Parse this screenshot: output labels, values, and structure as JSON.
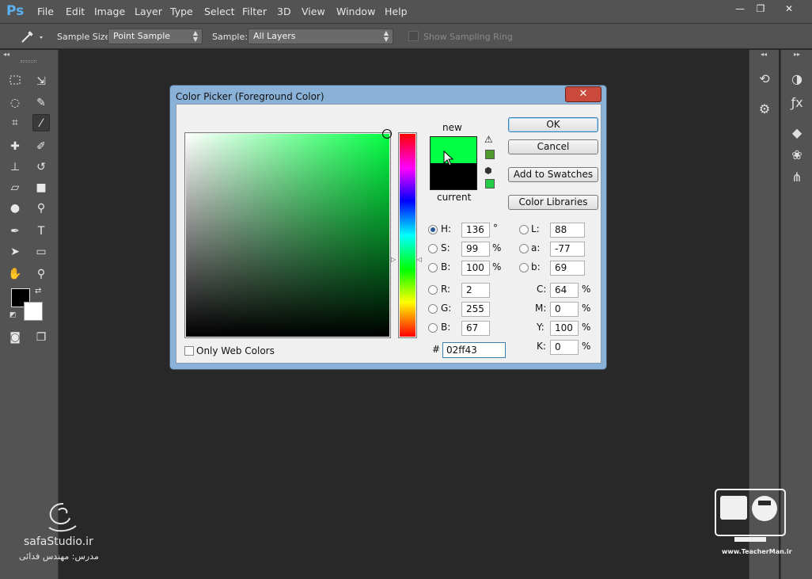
{
  "app": {
    "logo": "Ps"
  },
  "menu": [
    "File",
    "Edit",
    "Image",
    "Layer",
    "Type",
    "Select",
    "Filter",
    "3D",
    "View",
    "Window",
    "Help"
  ],
  "window_controls": {
    "minimize": "—",
    "restore": "❐",
    "close": "✕"
  },
  "options": {
    "sample_size_label": "Sample Size:",
    "sample_size_value": "Point Sample",
    "sample_label": "Sample:",
    "sample_value": "All Layers",
    "sampling_ring_label": "Show Sampling Ring"
  },
  "dialog": {
    "title": "Color Picker (Foreground Color)",
    "close": "✕",
    "new_label": "new",
    "current_label": "current",
    "buttons": {
      "ok": "OK",
      "cancel": "Cancel",
      "add_swatches": "Add to Swatches",
      "color_libraries": "Color Libraries"
    },
    "only_web_colors": "Only Web Colors",
    "hsb": {
      "h_label": "H:",
      "h": "136",
      "h_unit": "°",
      "s_label": "S:",
      "s": "99",
      "s_unit": "%",
      "b_label": "B:",
      "b": "100",
      "b_unit": "%"
    },
    "rgb": {
      "r_label": "R:",
      "r": "2",
      "g_label": "G:",
      "g": "255",
      "b_label": "B:",
      "b": "67"
    },
    "lab": {
      "l_label": "L:",
      "l": "88",
      "a_label": "a:",
      "a": "-77",
      "b_label": "b:",
      "b": "69"
    },
    "cmyk": {
      "c_label": "C:",
      "c": "64",
      "m_label": "M:",
      "m": "0",
      "y_label": "Y:",
      "y": "100",
      "k_label": "K:",
      "k": "0",
      "unit": "%"
    },
    "hex_label": "#",
    "hex": "02ff43",
    "new_color": "#02ff43",
    "current_color": "#000000",
    "gamut_swatch": "#4f9a2c",
    "web_swatch": "#22cc44"
  },
  "watermarks": {
    "left_site": "safaStudio.ir",
    "left_caption": "مدرس: مهندس فدائی",
    "right_site": "www.TeacherMan.ir"
  }
}
